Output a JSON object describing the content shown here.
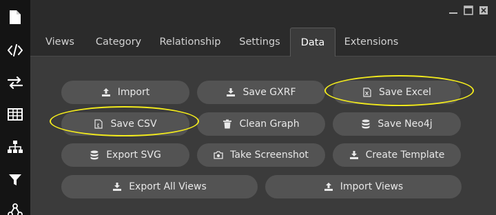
{
  "window": {
    "controls": [
      {
        "name": "minimize-window-button",
        "icon": "minimize-icon"
      },
      {
        "name": "maximize-window-button",
        "icon": "maximize-icon"
      },
      {
        "name": "close-window-button",
        "icon": "close-icon"
      }
    ]
  },
  "sidebar": {
    "items": [
      {
        "icon": "document-icon"
      },
      {
        "icon": "code-icon"
      },
      {
        "icon": "swap-arrows-icon"
      },
      {
        "icon": "table-icon"
      },
      {
        "icon": "hierarchy-icon"
      },
      {
        "icon": "filter-icon"
      },
      {
        "icon": "network-icon"
      }
    ]
  },
  "tabs": [
    {
      "label": "Views",
      "active": false
    },
    {
      "label": "Category",
      "active": false
    },
    {
      "label": "Relationship",
      "active": false
    },
    {
      "label": "Settings",
      "active": false
    },
    {
      "label": "Data",
      "active": true
    },
    {
      "label": "Extensions",
      "active": false
    }
  ],
  "buttons": {
    "import": {
      "label": "Import",
      "icon": "upload-icon"
    },
    "save_gxrf": {
      "label": "Save GXRF",
      "icon": "download-icon"
    },
    "save_excel": {
      "label": "Save Excel",
      "icon": "excel-file-icon"
    },
    "save_csv": {
      "label": "Save CSV",
      "icon": "csv-file-icon"
    },
    "clean_graph": {
      "label": "Clean Graph",
      "icon": "trash-icon"
    },
    "save_neo4j": {
      "label": "Save Neo4j",
      "icon": "database-icon"
    },
    "export_svg": {
      "label": "Export SVG",
      "icon": "database-icon"
    },
    "take_screenshot": {
      "label": "Take Screenshot",
      "icon": "camera-icon"
    },
    "create_template": {
      "label": "Create Template",
      "icon": "download-icon"
    },
    "export_all_views": {
      "label": "Export All Views",
      "icon": "download-icon"
    },
    "import_views": {
      "label": "Import Views",
      "icon": "upload-icon"
    }
  },
  "colors": {
    "highlight": "#f2ea1d",
    "sidebar_bg": "#141414",
    "panel_bg": "#3b3b3b",
    "button_bg": "#535353"
  }
}
